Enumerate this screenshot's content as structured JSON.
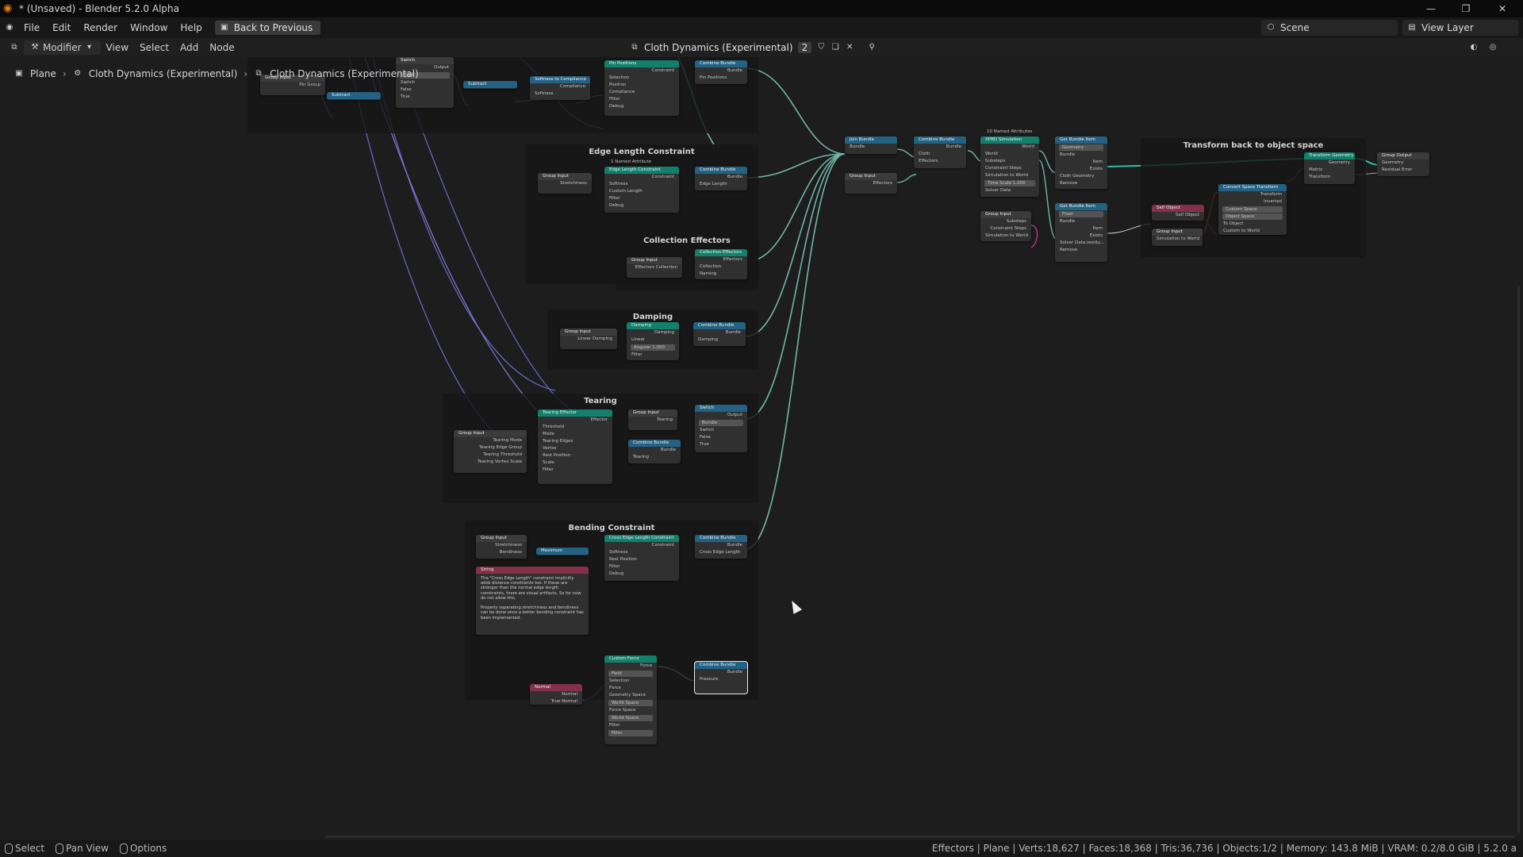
{
  "window": {
    "title": "* (Unsaved) - Blender 5.2.0 Alpha",
    "controls": [
      "—",
      "❐",
      "✕"
    ]
  },
  "menubar": {
    "items": [
      "File",
      "Edit",
      "Render",
      "Window",
      "Help"
    ],
    "back_label": "Back to Previous",
    "scene_label": "Scene",
    "view_layer_label": "View Layer"
  },
  "editor_header": {
    "mode_label": "Modifier",
    "menus": [
      "View",
      "Select",
      "Add",
      "Node"
    ],
    "tree_name": "Cloth Dynamics (Experimental)",
    "users_count": "2"
  },
  "breadcrumb": {
    "object": "Plane",
    "modifier": "Cloth Dynamics (Experimental)",
    "group": "Cloth Dynamics (Experimental)"
  },
  "frames": {
    "edge_length": "Edge Length Constraint",
    "collection_effectors": "Collection Effectors",
    "damping": "Damping",
    "tearing": "Tearing",
    "bending": "Bending Constraint",
    "transform_back": "Transform back to object space"
  },
  "nodes": {
    "pin": {
      "group_input": {
        "title": "Group Input",
        "rows": [
          "Pin Group"
        ]
      },
      "switch": {
        "title": "Switch",
        "rows": [
          "Output",
          "Float",
          "Switch",
          "False",
          "True"
        ]
      },
      "subtract_a": {
        "title": "Subtract"
      },
      "subtract_b": {
        "title": "Subtract"
      },
      "softness": {
        "title": "Softness to Compliance",
        "rows": [
          "Compliance",
          "Softness"
        ]
      },
      "pin_positions": {
        "title": "Pin Positions",
        "rows": [
          "Constraint",
          "Selection",
          "Position",
          "Compliance",
          "Filter",
          "Debug"
        ]
      },
      "combine": {
        "title": "Combine Bundle",
        "rows": [
          "Bundle",
          "Pin Positions"
        ]
      }
    },
    "edge": {
      "named_attr": "1 Named Attribute",
      "group_input": {
        "title": "Group Input",
        "rows": [
          "Stretchiness"
        ]
      },
      "constraint": {
        "title": "Edge Length Constraint",
        "rows": [
          "Constraint",
          "Softness",
          "Custom Length",
          "Filter",
          "Debug"
        ]
      },
      "combine": {
        "title": "Combine Bundle",
        "rows": [
          "Bundle",
          "Edge Length"
        ]
      }
    },
    "collection": {
      "group_input": {
        "title": "Group Input",
        "rows": [
          "Effectors Collection"
        ]
      },
      "effectors": {
        "title": "Collection Effectors",
        "rows": [
          "Effectors",
          "Collection",
          "Naming"
        ]
      }
    },
    "damping": {
      "group_input": {
        "title": "Group Input",
        "rows": [
          "Linear Damping"
        ]
      },
      "damping": {
        "title": "Damping",
        "rows": [
          "Damping",
          "Linear",
          "Angular   1.000",
          "Filter"
        ]
      },
      "combine": {
        "title": "Combine Bundle",
        "rows": [
          "Bundle",
          "Damping"
        ]
      }
    },
    "tearing": {
      "group_input": {
        "title": "Group Input",
        "rows": [
          "Tearing Mode",
          "Tearing Edge Group",
          "Tearing Threshold",
          "Tearing Vertex Scale"
        ]
      },
      "effector": {
        "title": "Tearing Effector",
        "rows": [
          "Effector",
          "Threshold",
          "Mode",
          "Tearing Edges",
          "Vertex",
          "Rest Position",
          "Scale",
          "Filter"
        ]
      },
      "group_input_b": {
        "title": "Group Input",
        "rows": [
          "Tearing"
        ]
      },
      "combine": {
        "title": "Combine Bundle",
        "rows": [
          "Bundle",
          "Tearing"
        ]
      },
      "switch": {
        "title": "Switch",
        "rows": [
          "Output",
          "Bundle",
          "Switch",
          "False",
          "True"
        ]
      }
    },
    "bending": {
      "group_input": {
        "title": "Group Input",
        "rows": [
          "Stretchiness",
          "Bendiness"
        ]
      },
      "maximum": {
        "title": "Maximum"
      },
      "cross": {
        "title": "Cross Edge Length Constraint",
        "rows": [
          "Constraint",
          "Softness",
          "Rest Position",
          "Filter",
          "Debug"
        ]
      },
      "combine": {
        "title": "Combine Bundle",
        "rows": [
          "Bundle",
          "Cross Edge Length"
        ]
      },
      "string_title": "String",
      "note": "The \"Cross Edge Length\" constraint implicitly adds distance constraints too. If these are stronger than the normal edge length constraints, there are visual artifacts. So for now do not allow this.\n\nProperly separating stretchiness and bendiness can be done once a better bending constraint has been implemented."
    },
    "pressure": {
      "normal": {
        "title": "Normal",
        "rows": [
          "Normal",
          "True Normal"
        ]
      },
      "custom_force": {
        "title": "Custom Force",
        "rows": [
          "Force",
          "Field",
          "Selection",
          "Force",
          "Geometry Space",
          "World Space",
          "Force Space",
          "World Space",
          "Filter",
          "Filter"
        ]
      },
      "combine": {
        "title": "Combine Bundle",
        "rows": [
          "Bundle",
          "Pressure"
        ]
      }
    },
    "mid": {
      "join": {
        "title": "Join Bundle",
        "rows": [
          "Bundle"
        ]
      },
      "group_input": {
        "title": "Group Input",
        "rows": [
          "Effectors"
        ]
      },
      "combine": {
        "title": "Combine Bundle",
        "rows": [
          "Bundle",
          "Cloth",
          "Effectors"
        ]
      },
      "named_attrs": "10 Named Attributes",
      "xpbd": {
        "title": "XPBD Simulation",
        "rows": [
          "World",
          "World",
          "Substeps",
          "Constraint Steps",
          "Simulation to World",
          "Time Scale   1.000",
          "Solver Data"
        ]
      },
      "group_input_b": {
        "title": "Group Input",
        "rows": [
          "Substeps",
          "Constraint Steps",
          "Simulation to World"
        ]
      }
    },
    "right": {
      "get_item_a": {
        "title": "Get Bundle Item",
        "rows": [
          "Geometry",
          "Bundle",
          "Item",
          "Exists",
          "Cloth Geometry",
          "Remove"
        ]
      },
      "get_item_b": {
        "title": "Get Bundle Item",
        "rows": [
          "Float",
          "Bundle",
          "Item",
          "Exists",
          "Solver Data.residu...",
          "Remove"
        ]
      },
      "self_object": {
        "title": "Self Object",
        "rows": [
          "Self Object"
        ]
      },
      "group_input": {
        "title": "Group Input",
        "rows": [
          "Simulation to World"
        ]
      },
      "convert": {
        "title": "Convert Space Transform",
        "rows": [
          "Transform",
          "Inverted",
          "Custom Space",
          "Object Space",
          "To Object",
          "Custom to World"
        ]
      },
      "transform_geo": {
        "title": "Transform Geometry",
        "rows": [
          "Geometry",
          "Matrix",
          "Transform"
        ]
      },
      "group_output": {
        "title": "Group Output",
        "rows": [
          "Geometry",
          "Residual Error"
        ]
      }
    }
  },
  "status": {
    "hints": [
      "Select",
      "Pan View",
      "Options"
    ],
    "stats": "Effectors | Plane | Verts:18,627 | Faces:18,368 | Tris:36,736 | Objects:1/2 | Memory: 143.8 MiB | VRAM: 0.2/8.0 GiB | 5.2.0 a"
  },
  "colors": {
    "geometry_wire": "#2fc0a0",
    "bundle_wire": "#6fb7a6",
    "float_wire": "#9a9ab0",
    "frame_bg": "#161616",
    "node_bg": "#303030",
    "header_geometry": "#12806a",
    "header_converter": "#246283",
    "header_input": "#83314a"
  }
}
